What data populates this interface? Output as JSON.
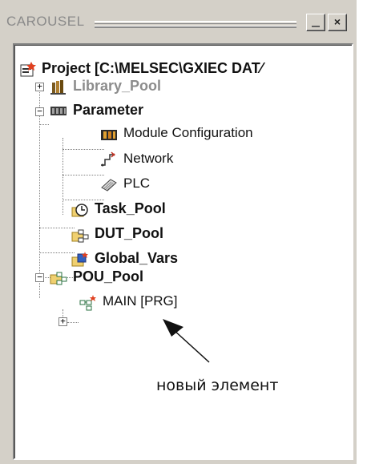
{
  "window": {
    "title": "CAROUSEL",
    "minimize_label": "_",
    "close_label": "×"
  },
  "tree": {
    "root": "Project [C:\\MELSEC\\GXIEC DAT⁄",
    "library_pool": "Library_Pool",
    "parameter": "Parameter",
    "module_configuration": "Module Configuration",
    "network": "Network",
    "plc": "PLC",
    "task_pool": "Task_Pool",
    "dut_pool": "DUT_Pool",
    "global_vars": "Global_Vars",
    "pou_pool": "POU_Pool",
    "main_prg": "MAIN [PRG]"
  },
  "expanders": {
    "plus": "+",
    "minus": "−"
  },
  "annotation": {
    "text": "новый элемент"
  }
}
